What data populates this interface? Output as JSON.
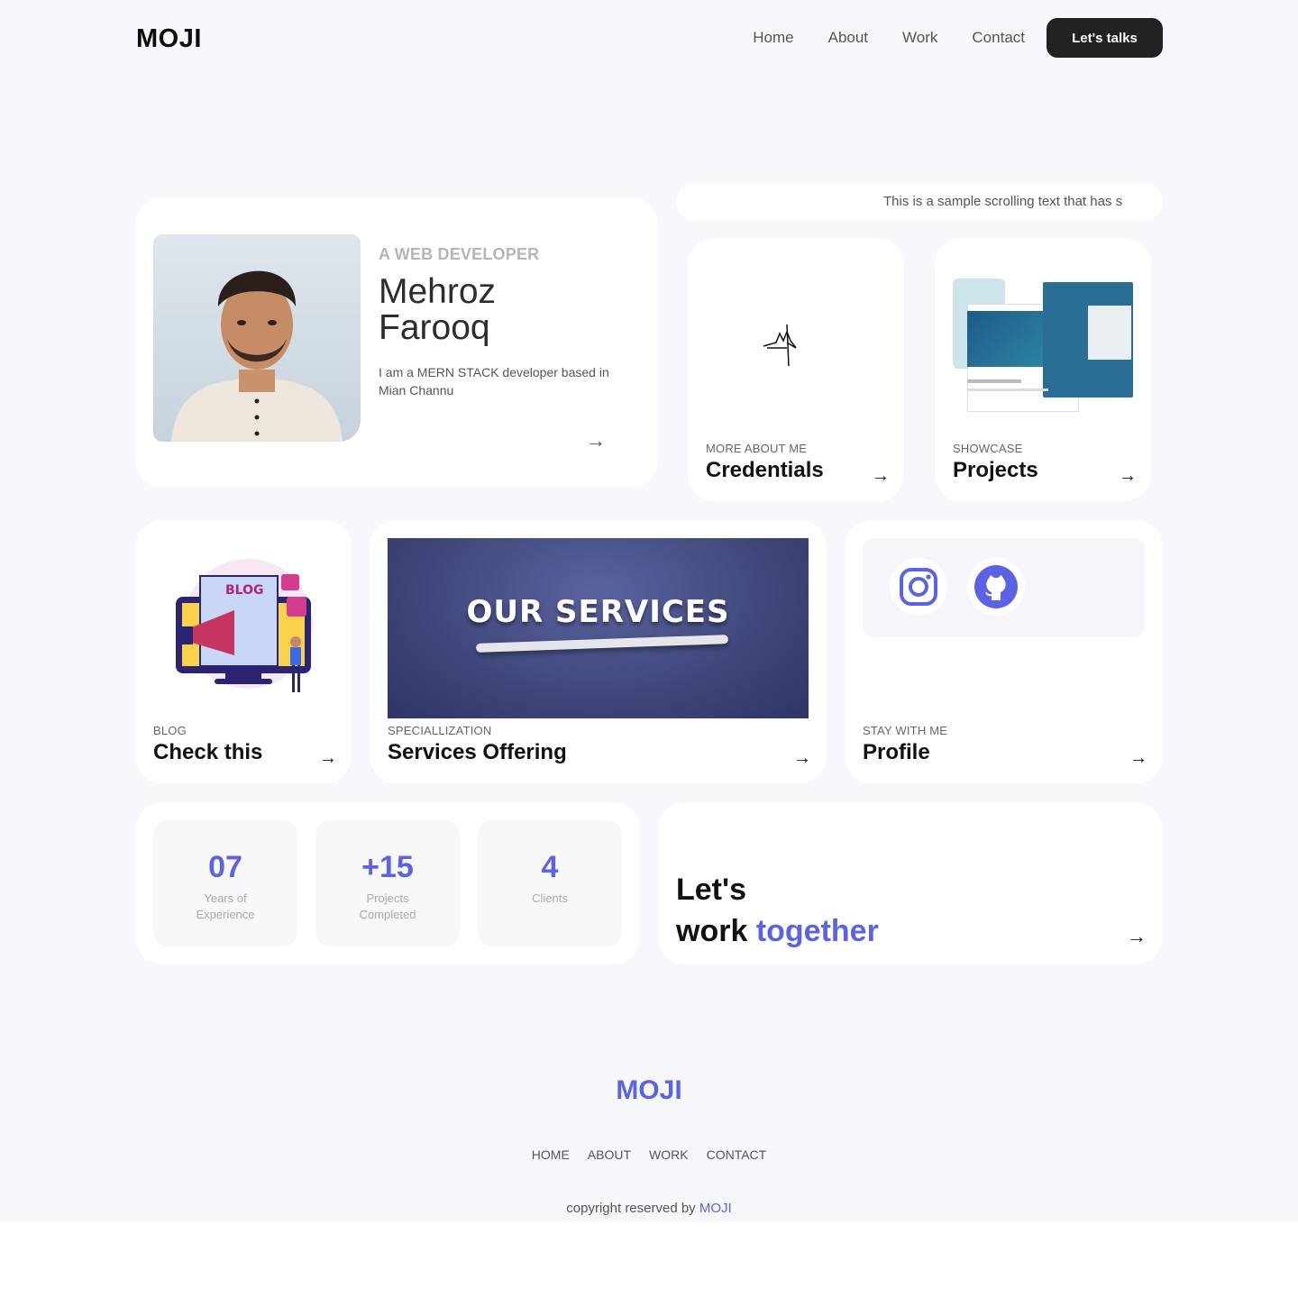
{
  "header": {
    "logo": "MOJI",
    "nav": [
      "Home",
      "About",
      "Work",
      "Contact"
    ],
    "cta": "Let's talks"
  },
  "hero": {
    "role": "A WEB DEVELOPER",
    "name": "Mehroz Farooq",
    "bio": "I am a MERN STACK developer based in Mian Channu"
  },
  "ticker": {
    "text": "This is a sample scrolling text that has s"
  },
  "credentials": {
    "kicker": "MORE ABOUT ME",
    "title": "Credentials"
  },
  "projects": {
    "kicker": "SHOWCASE",
    "title": "Projects"
  },
  "blog": {
    "kicker": "BLOG",
    "title": "Check this",
    "illustration_text": "BLOG"
  },
  "services": {
    "kicker": "SPECIALLIZATION",
    "title": "Services Offering",
    "banner_text": "OUR SERVICES"
  },
  "profile": {
    "kicker": "STAY WITH ME",
    "title": "Profile",
    "icons": [
      "instagram-icon",
      "github-icon"
    ]
  },
  "stats": [
    {
      "value": "07",
      "label": "Years of Experience"
    },
    {
      "value": "+15",
      "label": "Projects Completed"
    },
    {
      "value": "4",
      "label": "Clients"
    }
  ],
  "collab": {
    "line1": "Let's",
    "line2_plain": "work",
    "line2_accent": "together"
  },
  "footer": {
    "logo": "MOJI",
    "nav": [
      "HOME",
      "ABOUT",
      "WORK",
      "CONTACT"
    ],
    "copyright_prefix": "copyright reserved by",
    "copyright_brand": "MOJI"
  },
  "colors": {
    "accent": "#5b63e4",
    "dark": "#222222",
    "bg": "#f7f8fc"
  }
}
